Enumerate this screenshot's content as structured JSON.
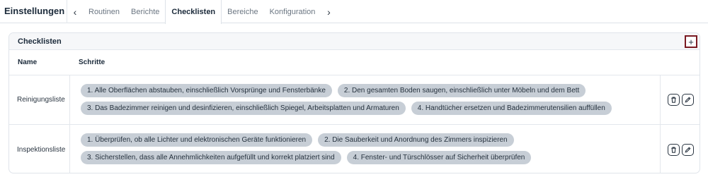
{
  "app": {
    "title": "Einstellungen"
  },
  "nav": {
    "prev_icon": "chevron-left-icon",
    "next_icon": "chevron-right-icon",
    "tabs": [
      {
        "label": "Routinen",
        "active": false
      },
      {
        "label": "Berichte",
        "active": false
      },
      {
        "label": "Checklisten",
        "active": true
      },
      {
        "label": "Bereiche",
        "active": false
      },
      {
        "label": "Konfiguration",
        "active": false
      }
    ]
  },
  "card": {
    "title": "Checklisten",
    "add_label": "+",
    "accent_color": "#7a1a22"
  },
  "table": {
    "headers": {
      "name": "Name",
      "steps": "Schritte"
    },
    "rows": [
      {
        "name": "Reinigungsliste",
        "steps": [
          [
            "1. Alle Oberflächen abstauben, einschließlich Vorsprünge und Fensterbänke",
            "2. Den gesamten Boden saugen, einschließlich unter Möbeln und dem Bett"
          ],
          [
            "3. Das Badezimmer reinigen und desinfizieren, einschließlich Spiegel, Arbeitsplatten und Armaturen",
            "4. Handtücher ersetzen und Badezimmerutensilien auffüllen"
          ]
        ],
        "actions": [
          "trash-icon",
          "pencil-icon"
        ]
      },
      {
        "name": "Inspektionsliste",
        "steps": [
          [
            "1. Überprüfen, ob alle Lichter und elektronischen Geräte funktionieren",
            "2. Die Sauberkeit und Anordnung des Zimmers inspizieren"
          ],
          [
            "3. Sicherstellen, dass alle Annehmlichkeiten aufgefüllt und korrekt platziert sind",
            "4. Fenster- und Türschlösser auf Sicherheit überprüfen"
          ]
        ],
        "actions": [
          "trash-icon",
          "pencil-icon"
        ]
      }
    ]
  }
}
